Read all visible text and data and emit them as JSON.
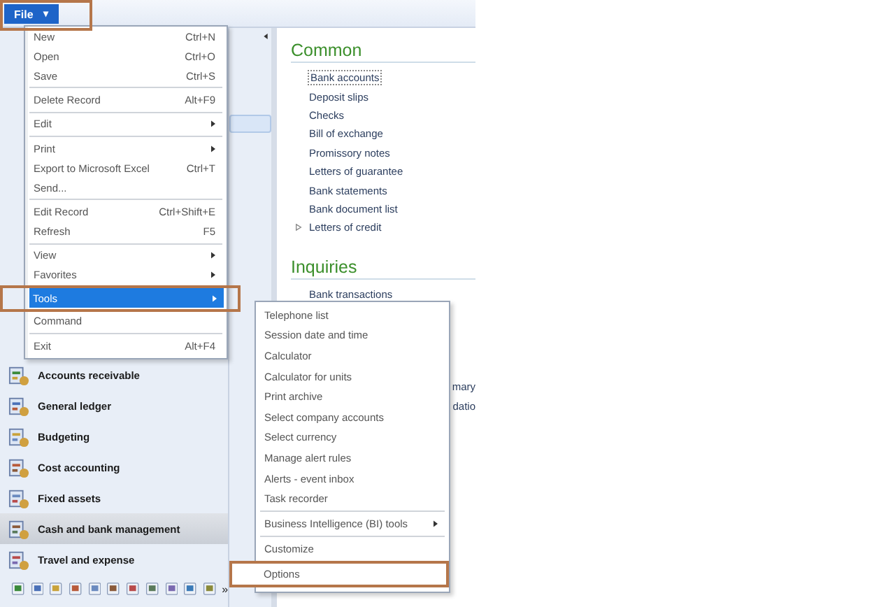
{
  "file_button": {
    "label": "File",
    "caret": "▾",
    "annotated": true
  },
  "file_menu": {
    "items": [
      {
        "kind": "item",
        "label": "New",
        "shortcut": "Ctrl+N",
        "submenu": false,
        "selected": false,
        "annotated": false
      },
      {
        "kind": "item",
        "label": "Open",
        "shortcut": "Ctrl+O",
        "submenu": false,
        "selected": false,
        "annotated": false
      },
      {
        "kind": "item",
        "label": "Save",
        "shortcut": "Ctrl+S",
        "submenu": false,
        "selected": false,
        "annotated": false
      },
      {
        "kind": "separator"
      },
      {
        "kind": "item",
        "label": "Delete Record",
        "shortcut": "Alt+F9",
        "submenu": false,
        "selected": false,
        "annotated": false
      },
      {
        "kind": "separator"
      },
      {
        "kind": "item",
        "label": "Edit",
        "submenu": true,
        "selected": false,
        "annotated": false
      },
      {
        "kind": "separator"
      },
      {
        "kind": "item",
        "label": "Print",
        "submenu": true,
        "selected": false,
        "annotated": false
      },
      {
        "kind": "item",
        "label": "Export to Microsoft Excel",
        "shortcut": "Ctrl+T",
        "submenu": false,
        "selected": false,
        "annotated": false
      },
      {
        "kind": "item",
        "label": "Send...",
        "submenu": false,
        "selected": false,
        "annotated": false
      },
      {
        "kind": "separator"
      },
      {
        "kind": "item",
        "label": "Edit Record",
        "shortcut": "Ctrl+Shift+E",
        "submenu": false,
        "selected": false,
        "annotated": false
      },
      {
        "kind": "item",
        "label": "Refresh",
        "shortcut": "F5",
        "submenu": false,
        "selected": false,
        "annotated": false
      },
      {
        "kind": "separator"
      },
      {
        "kind": "item",
        "label": "View",
        "submenu": true,
        "selected": false,
        "annotated": false
      },
      {
        "kind": "item",
        "label": "Favorites",
        "submenu": true,
        "selected": false,
        "annotated": false
      },
      {
        "kind": "item",
        "label": "Tools",
        "submenu": true,
        "selected": true,
        "annotated": true
      },
      {
        "kind": "item",
        "label": "Command",
        "submenu": false,
        "selected": false,
        "annotated": false
      },
      {
        "kind": "separator"
      },
      {
        "kind": "item",
        "label": "Exit",
        "shortcut": "Alt+F4",
        "submenu": false,
        "selected": false,
        "annotated": false
      }
    ]
  },
  "tools_submenu": {
    "items": [
      {
        "kind": "item",
        "label": "Telephone list",
        "submenu": false,
        "annotated": false
      },
      {
        "kind": "item",
        "label": "Session date and time",
        "submenu": false,
        "annotated": false
      },
      {
        "kind": "item",
        "label": "Calculator",
        "submenu": false,
        "annotated": false
      },
      {
        "kind": "item",
        "label": "Calculator for units",
        "submenu": false,
        "annotated": false
      },
      {
        "kind": "item",
        "label": "Print archive",
        "submenu": false,
        "annotated": false
      },
      {
        "kind": "item",
        "label": "Select company accounts",
        "submenu": false,
        "annotated": false
      },
      {
        "kind": "item",
        "label": "Select currency",
        "submenu": false,
        "annotated": false
      },
      {
        "kind": "item",
        "label": "Manage alert rules",
        "submenu": false,
        "annotated": false
      },
      {
        "kind": "item",
        "label": "Alerts - event inbox",
        "submenu": false,
        "annotated": false
      },
      {
        "kind": "item",
        "label": "Task recorder",
        "submenu": false,
        "annotated": false
      },
      {
        "kind": "separator"
      },
      {
        "kind": "item",
        "label": "Business Intelligence (BI) tools",
        "submenu": true,
        "annotated": false
      },
      {
        "kind": "separator"
      },
      {
        "kind": "item",
        "label": "Customize",
        "submenu": false,
        "annotated": false
      },
      {
        "kind": "item",
        "label": "Options",
        "submenu": false,
        "annotated": true
      }
    ]
  },
  "modules": [
    {
      "label": "Accounts receivable",
      "selected": false
    },
    {
      "label": "General ledger",
      "selected": false
    },
    {
      "label": "Budgeting",
      "selected": false
    },
    {
      "label": "Cost accounting",
      "selected": false
    },
    {
      "label": "Fixed assets",
      "selected": false
    },
    {
      "label": "Cash and bank management",
      "selected": true
    },
    {
      "label": "Travel and expense",
      "selected": false
    }
  ],
  "shortcut_bar": {
    "more": "»"
  },
  "common": {
    "heading": "Common",
    "items": [
      {
        "label": "Bank accounts",
        "focused": true,
        "expandable": false
      },
      {
        "label": "Deposit slips",
        "focused": false,
        "expandable": false
      },
      {
        "label": "Checks",
        "focused": false,
        "expandable": false
      },
      {
        "label": "Bill of exchange",
        "focused": false,
        "expandable": false
      },
      {
        "label": "Promissory notes",
        "focused": false,
        "expandable": false
      },
      {
        "label": "Letters of guarantee",
        "focused": false,
        "expandable": false
      },
      {
        "label": "Bank statements",
        "focused": false,
        "expandable": false
      },
      {
        "label": "Bank document list",
        "focused": false,
        "expandable": false
      },
      {
        "label": "Letters of credit",
        "focused": false,
        "expandable": true
      }
    ]
  },
  "inquiries": {
    "heading": "Inquiries",
    "items": [
      "Bank transactions"
    ],
    "partly_hidden": [
      "mary",
      "datio"
    ]
  }
}
